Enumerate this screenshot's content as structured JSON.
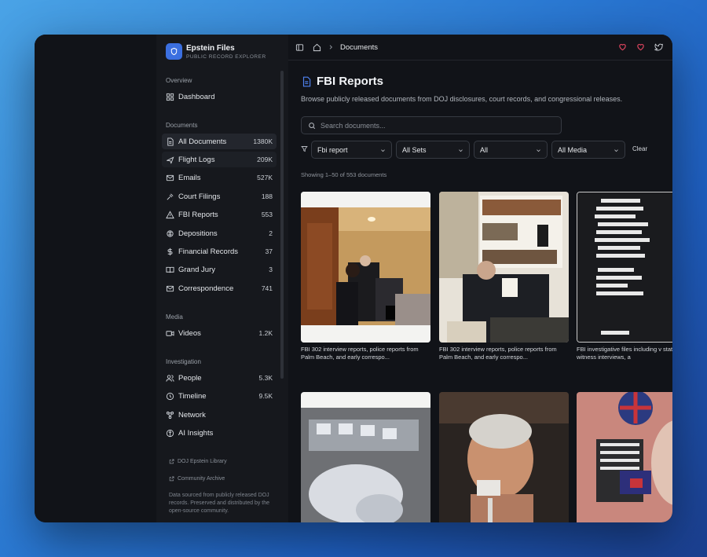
{
  "brand": {
    "title": "Epstein Files",
    "subtitle": "PUBLIC RECORD EXPLORER"
  },
  "sidebar": {
    "overview_label": "Overview",
    "dashboard": "Dashboard",
    "documents_label": "Documents",
    "documents": [
      {
        "label": "All Documents",
        "count": "1380K"
      },
      {
        "label": "Flight Logs",
        "count": "209K"
      },
      {
        "label": "Emails",
        "count": "527K"
      },
      {
        "label": "Court Filings",
        "count": "188"
      },
      {
        "label": "FBI Reports",
        "count": "553"
      },
      {
        "label": "Depositions",
        "count": "2"
      },
      {
        "label": "Financial Records",
        "count": "37"
      },
      {
        "label": "Grand Jury",
        "count": "3"
      },
      {
        "label": "Correspondence",
        "count": "741"
      }
    ],
    "media_label": "Media",
    "media": [
      {
        "label": "Videos",
        "count": "1.2K"
      }
    ],
    "investigation_label": "Investigation",
    "investigation": [
      {
        "label": "People",
        "count": "5.3K"
      },
      {
        "label": "Timeline",
        "count": "9.5K"
      },
      {
        "label": "Network",
        "count": ""
      },
      {
        "label": "AI Insights",
        "count": ""
      }
    ],
    "footer_links": [
      "DOJ Epstein Library",
      "Community Archive"
    ],
    "footer_note": "Data sourced from publicly released DOJ records. Preserved and distributed by the open-source community."
  },
  "topbar": {
    "crumb": "Documents"
  },
  "page": {
    "title": "FBI Reports",
    "description": "Browse publicly released documents from DOJ disclosures, court records, and congressional releases.",
    "search_placeholder": "Search documents...",
    "filters": [
      "Fbi report",
      "All Sets",
      "All",
      "All Media"
    ],
    "clear_label": "Clear",
    "showing": "Showing 1–50 of 553 documents"
  },
  "cards": [
    {
      "caption": "FBI 302 interview reports, police reports from Palm Beach, and early correspo..."
    },
    {
      "caption": "FBI 302 interview reports, police reports from Palm Beach, and early correspo..."
    },
    {
      "caption": "FBI investigative files including v statements, witness interviews, a"
    },
    {
      "caption": ""
    },
    {
      "caption": ""
    },
    {
      "caption": ""
    }
  ],
  "colors": {
    "accent": "#3b6fe0",
    "heart": "#e0455f",
    "background": "#111318"
  }
}
